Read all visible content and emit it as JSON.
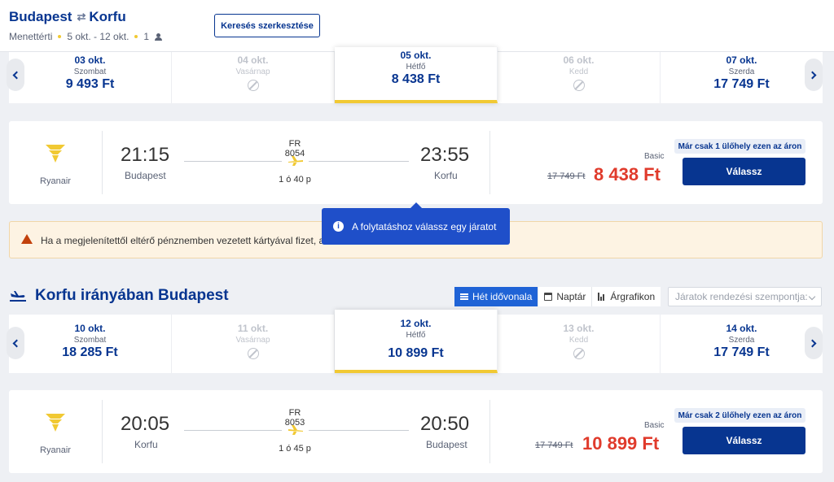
{
  "header": {
    "origin": "Budapest",
    "destination": "Korfu",
    "trip_type": "Menettérti",
    "dates": "5 okt. - 12 okt.",
    "passengers": "1",
    "edit_label": "Keresés szerkesztése"
  },
  "outbound_dates": [
    {
      "date": "03 okt.",
      "weekday": "Szombat",
      "price": "9 493 Ft",
      "available": true
    },
    {
      "date": "04 okt.",
      "weekday": "Vasárnap",
      "price": "",
      "available": false
    },
    {
      "date": "05 okt.",
      "weekday": "Hétfő",
      "price": "8 438 Ft",
      "available": true,
      "selected": true
    },
    {
      "date": "06 okt.",
      "weekday": "Kedd",
      "price": "",
      "available": false
    },
    {
      "date": "07 okt.",
      "weekday": "Szerda",
      "price": "17 749 Ft",
      "available": true
    }
  ],
  "outbound_flight": {
    "airline": "Ryanair",
    "dep_time": "21:15",
    "dep_city": "Budapest",
    "flight_no": "FR 8054",
    "duration": "1 ó 40 p",
    "arr_time": "23:55",
    "arr_city": "Korfu",
    "fare": "Basic",
    "old_price": "17 749 Ft",
    "price": "8 438 Ft",
    "seats_note": "Már csak 1 ülőhely ezen az áron",
    "select_label": "Válassz"
  },
  "warning": {
    "text": "Ha a megjelenítettől eltérő pénznemben vezetett kártyával fizet, a"
  },
  "tooltip": {
    "text": "A folytatáshoz válassz egy járatot"
  },
  "return_section": {
    "title": "Korfu irányában Budapest",
    "tabs": [
      "Hét idővonala",
      "Naptár",
      "Árgrafikon"
    ],
    "sort_placeholder": "Járatok rendezési szempontja:"
  },
  "return_dates": [
    {
      "date": "10 okt.",
      "weekday": "Szombat",
      "price": "18 285 Ft",
      "available": true
    },
    {
      "date": "11 okt.",
      "weekday": "Vasárnap",
      "price": "",
      "available": false
    },
    {
      "date": "12 okt.",
      "weekday": "Hétfő",
      "price": "10 899 Ft",
      "available": true,
      "selected": true
    },
    {
      "date": "13 okt.",
      "weekday": "Kedd",
      "price": "",
      "available": false
    },
    {
      "date": "14 okt.",
      "weekday": "Szerda",
      "price": "17 749 Ft",
      "available": true
    }
  ],
  "return_flight": {
    "airline": "Ryanair",
    "dep_time": "20:05",
    "dep_city": "Korfu",
    "flight_no": "FR 8053",
    "duration": "1 ó 45 p",
    "arr_time": "20:50",
    "arr_city": "Budapest",
    "fare": "Basic",
    "old_price": "17 749 Ft",
    "price": "10 899 Ft",
    "seats_note": "Már csak 2 ülőhely ezen az áron",
    "select_label": "Válassz"
  },
  "colors": {
    "brand_blue": "#073590",
    "accent_yellow": "#f1c933",
    "price_red": "#e03b2c",
    "tooltip_blue": "#1f4fc9"
  }
}
